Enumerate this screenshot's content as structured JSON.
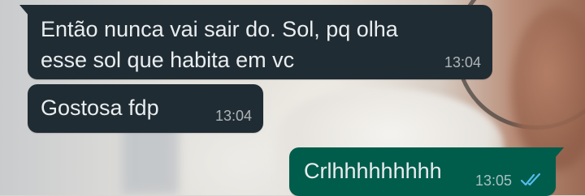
{
  "messages": [
    {
      "direction": "incoming",
      "lines": [
        "Então nunca vai sair do. Sol, pq olha",
        "esse sol que habita em vc"
      ],
      "time": "13:04"
    },
    {
      "direction": "incoming",
      "text": "Gostosa fdp",
      "time": "13:04"
    },
    {
      "direction": "outgoing",
      "text": "Crlhhhhhhhhh",
      "time": "13:05",
      "status_icon": "double-check-read-icon"
    }
  ],
  "colors": {
    "incoming_bubble": "#202c33",
    "outgoing_bubble": "#005c4b",
    "text": "#e9edef",
    "read_ticks": "#53bdeb"
  }
}
